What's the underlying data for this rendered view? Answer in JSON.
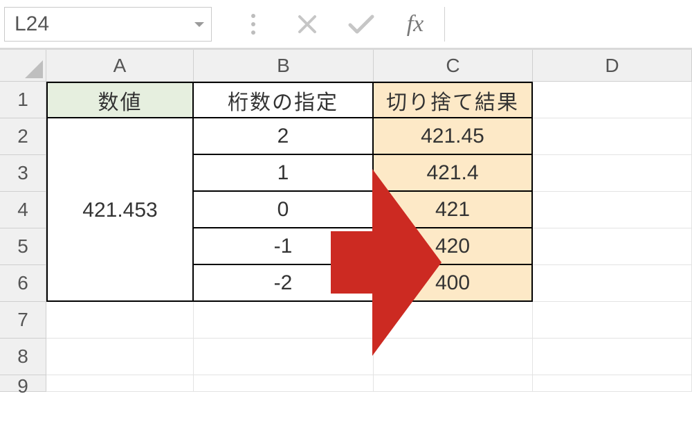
{
  "formula_bar": {
    "name_box": "L24",
    "cancel_icon": "cancel-icon",
    "confirm_icon": "confirm-icon",
    "fx_label": "fx",
    "formula_value": ""
  },
  "columns": [
    "A",
    "B",
    "C",
    "D"
  ],
  "row_numbers": [
    "1",
    "2",
    "3",
    "4",
    "5",
    "6",
    "7",
    "8",
    "9"
  ],
  "headers": {
    "A": "数値",
    "B": "桁数の指定",
    "C": "切り捨て結果"
  },
  "merged_A": "421.453",
  "colB": [
    "2",
    "1",
    "0",
    "-1",
    "-2"
  ],
  "colC": [
    "421.45",
    "421.4",
    "421",
    "420",
    "400"
  ],
  "colors": {
    "headerA_bg": "#e6efdf",
    "result_bg": "#fde9c7",
    "arrow": "#cc2a22"
  },
  "chart_data": {
    "type": "table",
    "title": "切り捨て結果",
    "columns": [
      "数値",
      "桁数の指定",
      "切り捨て結果"
    ],
    "rows": [
      [
        421.453,
        2,
        421.45
      ],
      [
        421.453,
        1,
        421.4
      ],
      [
        421.453,
        0,
        421
      ],
      [
        421.453,
        -1,
        420
      ],
      [
        421.453,
        -2,
        400
      ]
    ]
  }
}
